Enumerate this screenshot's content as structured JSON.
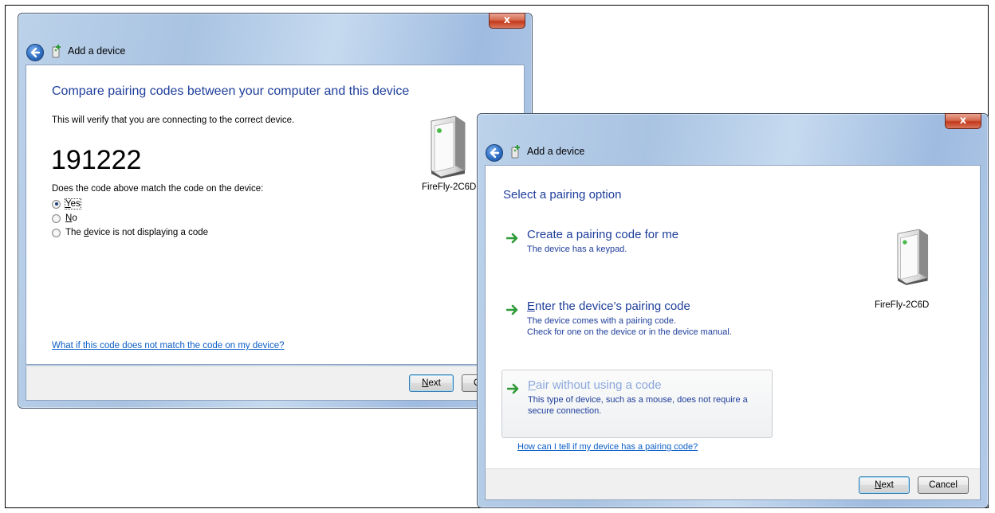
{
  "colors": {
    "heading": "#1e3e9b",
    "link": "#0a5ec7",
    "arrow": "#2e9b38",
    "close": "#c4391c"
  },
  "window1": {
    "title": "Add a device",
    "close_label": "x",
    "heading": "Compare pairing codes between your computer and this device",
    "verify_text": "This will verify that you are connecting to the correct device.",
    "code": "191222",
    "question": "Does the code above match the code on the device:",
    "options": [
      {
        "pre": "",
        "key": "Y",
        "post": "es",
        "checked": true
      },
      {
        "pre": "",
        "key": "N",
        "post": "o",
        "checked": false
      },
      {
        "pre": "The ",
        "key": "d",
        "post": "evice is not displaying a code",
        "checked": false
      }
    ],
    "device_label": "FireFly-2C6D",
    "help_link": "What if this code does not match the code on my device?",
    "next_key": "N",
    "next_rest": "ext",
    "cancel_label": "C"
  },
  "window2": {
    "title": "Add a device",
    "close_label": "x",
    "heading": "Select a pairing option",
    "options": [
      {
        "title": "Create a pairing code for me",
        "desc1": "The device has a keypad.",
        "desc2": "",
        "hover": false
      },
      {
        "title_key": "E",
        "title_rest": "nter the device’s pairing code",
        "desc1": "The device comes with a pairing code.",
        "desc2": "Check for one on the device or in the device manual.",
        "hover": false
      },
      {
        "title_key": "P",
        "title_rest": "air without using a code",
        "desc1": "This type of device, such as a mouse, does not require a",
        "desc2": "secure connection.",
        "hover": true
      }
    ],
    "device_label": "FireFly-2C6D",
    "help_link": "How can I tell if my device has a pairing code?",
    "next_key": "N",
    "next_rest": "ext",
    "cancel_label": "Cancel"
  }
}
